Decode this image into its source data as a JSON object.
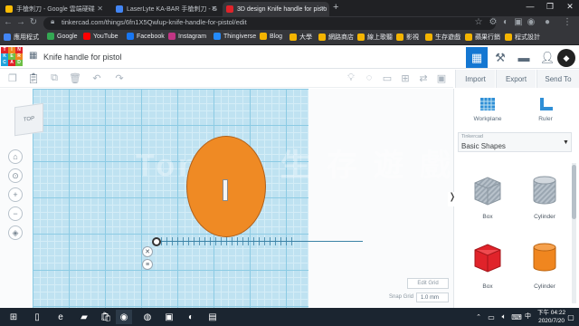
{
  "browser": {
    "tabs": [
      {
        "label": "手槍刺刀 - Google 雲端硬碟",
        "active": false
      },
      {
        "label": "LaserLyte KA-BAR 手槍刺刀 - G",
        "active": false
      },
      {
        "label": "3D design Knife handle for pisto",
        "active": true
      }
    ],
    "url": "tinkercad.com/things/6fn1X5Qwlup-knife-handle-for-pistol/edit",
    "bookmarks": [
      "應用程式",
      "Google",
      "YouTube",
      "Facebook",
      "Instagram",
      "Thingiverse",
      "Blog",
      "大學",
      "網路商店",
      "線上歌聽",
      "影視",
      "生存遊戲",
      "蘋果行銷",
      "程式設計"
    ]
  },
  "app": {
    "logo_letters": [
      "TIN",
      "KER",
      "CAD"
    ],
    "project_title": "Knife handle for pistol",
    "header_buttons": [
      "Import",
      "Export",
      "Send To"
    ]
  },
  "workplane": {
    "viewcube_label": "TOP",
    "watermark": "Tony の 生 存 遊 戲",
    "edit_grid": "Edit Grid",
    "snap_grid_label": "Snap Grid",
    "snap_grid_value": "1.0 mm"
  },
  "panel": {
    "tools": [
      "Workplane",
      "Ruler"
    ],
    "category_label": "Tinkercad",
    "category_value": "Basic Shapes",
    "shapes": [
      {
        "label": "Box",
        "color": "#a8b3bd",
        "icon": "box-striped-icon"
      },
      {
        "label": "Cylinder",
        "color": "#a8b3bd",
        "icon": "cylinder-striped-icon"
      },
      {
        "label": "Box",
        "color": "#e0232a",
        "icon": "box-red-icon"
      },
      {
        "label": "Cylinder",
        "color": "#f0861f",
        "icon": "cylinder-orange-icon"
      }
    ]
  },
  "taskbar": {
    "lang": "中",
    "time": "下午 04:22",
    "date": "2020/7/20"
  }
}
